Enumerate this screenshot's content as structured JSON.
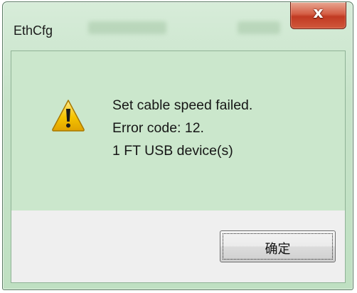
{
  "window": {
    "title": "EthCfg",
    "close_glyph": "x"
  },
  "message": {
    "icon": "warning-icon",
    "lines": [
      "Set cable speed failed.",
      "Error code: 12.",
      "1 FT USB device(s)"
    ]
  },
  "buttons": {
    "ok_label": "确定"
  },
  "colors": {
    "message_background": "#cbe7cc",
    "button_area_background": "#efefef",
    "close_button_red": "#c13a22",
    "warning_yellow": "#f5c400"
  }
}
